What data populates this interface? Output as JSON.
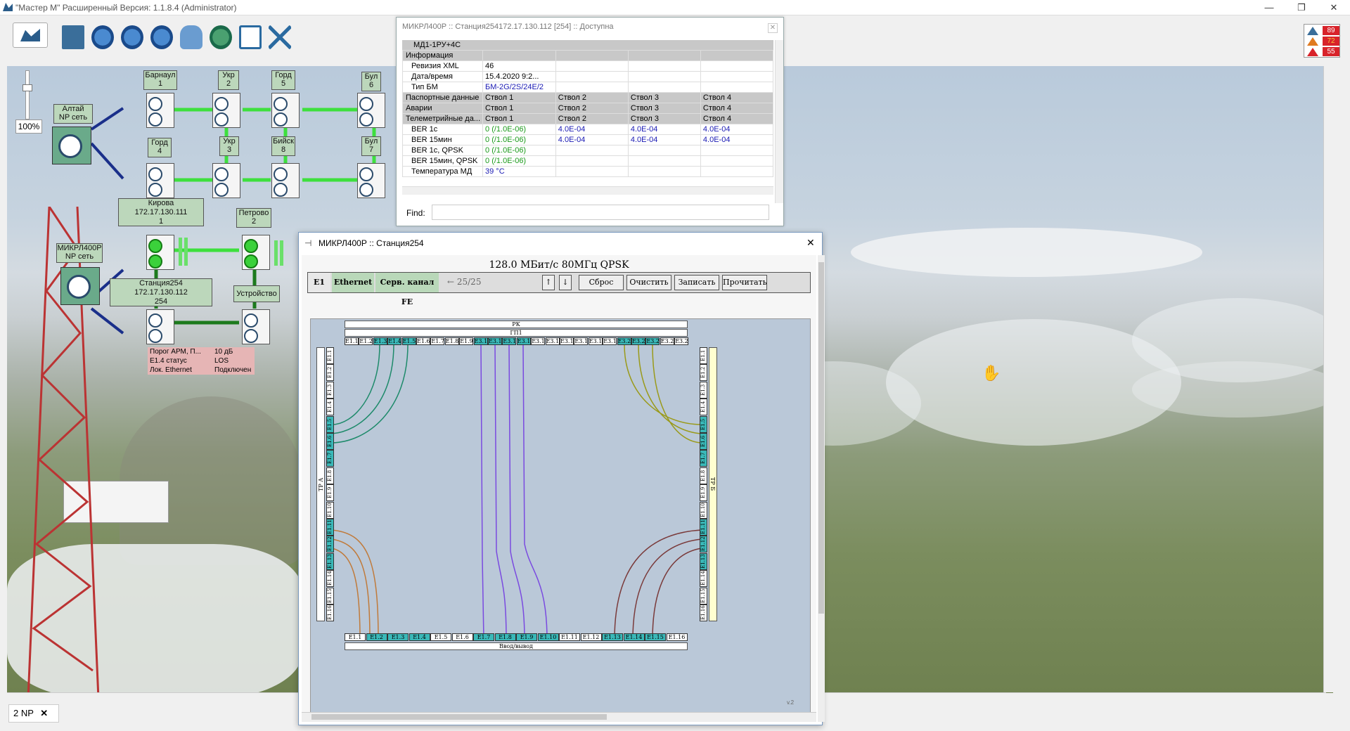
{
  "app": {
    "title": "\"Мастер М\" Расширенный Версия: 1.1.8.4 (Administrator)"
  },
  "toolbar": {
    "icons": [
      "map-icon",
      "save-icon",
      "globe-add-icon",
      "globe-delete-icon",
      "globe-refresh-icon",
      "users-icon",
      "globe-arrow-icon",
      "exit-icon",
      "tools-icon"
    ]
  },
  "alarms": {
    "critical": "89",
    "major": "72",
    "minor": "55"
  },
  "zoom": "100%",
  "map": {
    "nodes": [
      {
        "id": "altai",
        "label": "Алтай\nNP сеть"
      },
      {
        "id": "barnaul",
        "label": "Барнаул\n1"
      },
      {
        "id": "ukr2",
        "label": "Укр\n2"
      },
      {
        "id": "gorod5",
        "label": "Горд\n5"
      },
      {
        "id": "bul6",
        "label": "Бул\n6"
      },
      {
        "id": "gorod4",
        "label": "Горд\n4"
      },
      {
        "id": "ukr3",
        "label": "Укр\n3"
      },
      {
        "id": "biysk8",
        "label": "Бийск\n8"
      },
      {
        "id": "bul7",
        "label": "Бул\n7"
      },
      {
        "id": "kirova",
        "label": "Кирова\n172.17.130.111\n1"
      },
      {
        "id": "petrovo",
        "label": "Петрово\n2"
      },
      {
        "id": "mikrl",
        "label": "МИКРЛ400Р\nNP сеть"
      },
      {
        "id": "st254",
        "label": "Станция254\n172.17.130.112\n254"
      },
      {
        "id": "ustr",
        "label": "Устройство"
      }
    ],
    "status_table": [
      {
        "k": "Порог АРМ, П...",
        "v": "10 дБ"
      },
      {
        "k": "E1.4 статус",
        "v": "LOS"
      },
      {
        "k": "Лок. Ethernet",
        "v": "Подключен"
      }
    ]
  },
  "info_panel": {
    "title": "МИКРЛ400Р :: Станция254172.17.130.112 [254] :: Доступна",
    "root": "МД1-1РУ+4С",
    "rows": [
      {
        "type": "group",
        "label": "Информация",
        "c": [
          "",
          "",
          "",
          ""
        ]
      },
      {
        "label": "Ревизия XML",
        "c": [
          "46",
          "",
          "",
          ""
        ]
      },
      {
        "label": "Дата/время",
        "c": [
          "15.4.2020 9:2...",
          "",
          "",
          ""
        ]
      },
      {
        "label": "Тип БМ",
        "c": [
          "БМ-2G/2S/24E/2",
          "",
          "",
          ""
        ],
        "blue": true
      },
      {
        "type": "group",
        "label": "Паспортные данные",
        "c": [
          "Ствол 1",
          "Ствол 2",
          "Ствол 3",
          "Ствол 4"
        ]
      },
      {
        "type": "group",
        "label": "Аварии",
        "c": [
          "Ствол 1",
          "Ствол 2",
          "Ствол 3",
          "Ствол 4"
        ]
      },
      {
        "type": "group",
        "label": "Телеметрийные да...",
        "c": [
          "Ствол 1",
          "Ствол 2",
          "Ствол 3",
          "Ствол 4"
        ]
      },
      {
        "label": "BER 1с",
        "c": [
          "0  (/1.0E-06)",
          "4.0E-04",
          "4.0E-04",
          "4.0E-04"
        ],
        "green": true
      },
      {
        "label": "BER 15мин",
        "c": [
          "0  (/1.0E-06)",
          "4.0E-04",
          "4.0E-04",
          "4.0E-04"
        ],
        "green": true
      },
      {
        "label": "BER 1с, QPSK",
        "c": [
          "0  (/1.0E-06)",
          "",
          "",
          ""
        ],
        "green": true
      },
      {
        "label": "BER 15мин, QPSK",
        "c": [
          "0  (/1.0E-06)",
          "",
          "",
          ""
        ],
        "green": true
      },
      {
        "label": "Температура МД",
        "c": [
          "39 °С",
          "",
          "",
          ""
        ],
        "blue": true
      }
    ],
    "find_label": "Find:",
    "find_value": ""
  },
  "main_window": {
    "title": "МИКРЛ400Р :: Станция254",
    "header": "128.0 МБит/с 80МГц QPSK",
    "tabs": [
      "E1",
      "Ethernet",
      "Серв. канал FE"
    ],
    "counter": "← 25/25",
    "up": "↑",
    "down": "↓",
    "buttons": [
      "Сброс",
      "Очистить",
      "Записать",
      "Прочитать"
    ],
    "top_bar1": "РК",
    "top_bar2": "ГП1",
    "top_cells": [
      "E1.1",
      "E1.2",
      "E1.3",
      "E1.4",
      "E1.5",
      "E1.6",
      "E1.7",
      "E1.8",
      "E1.9",
      "E3.10",
      "E3.11",
      "E3.12",
      "E3.13",
      "E3.14",
      "E3.15",
      "E3.16",
      "E3.17",
      "E3.18",
      "E3.19",
      "E3.20",
      "E3.21",
      "E3.22",
      "E3.23",
      "E3.24"
    ],
    "top_active": [
      2,
      3,
      4,
      9,
      10,
      11,
      12,
      19,
      20,
      21
    ],
    "left_label": "ТР А",
    "right_label": "ТР Б",
    "side_cells": [
      "E1.1",
      "E1.2",
      "E1.3",
      "E1.4",
      "E1.5",
      "E1.6",
      "E1.7",
      "E1.8",
      "E1.9",
      "E1.10",
      "E1.11",
      "E1.12",
      "E1.13",
      "E1.14",
      "E1.15",
      "E1.16"
    ],
    "left_active": [
      4,
      5,
      6,
      10,
      11,
      12
    ],
    "right_active": [
      4,
      5,
      6,
      10,
      11,
      12
    ],
    "bottom_cells": [
      "E1.1",
      "E1.2",
      "E1.3",
      "E1.4",
      "E1.5",
      "E1.6",
      "E1.7",
      "E1.8",
      "E1.9",
      "E1.10",
      "E1.11",
      "E1.12",
      "E1.13",
      "E1.14",
      "E1.15",
      "E1.16"
    ],
    "bottom_active": [
      1,
      2,
      3,
      6,
      7,
      8,
      9,
      12,
      13,
      14
    ],
    "bottom_bar": "Ввод/вывод",
    "version": "v.2"
  },
  "bottom_tab": {
    "label": "2 NP"
  }
}
